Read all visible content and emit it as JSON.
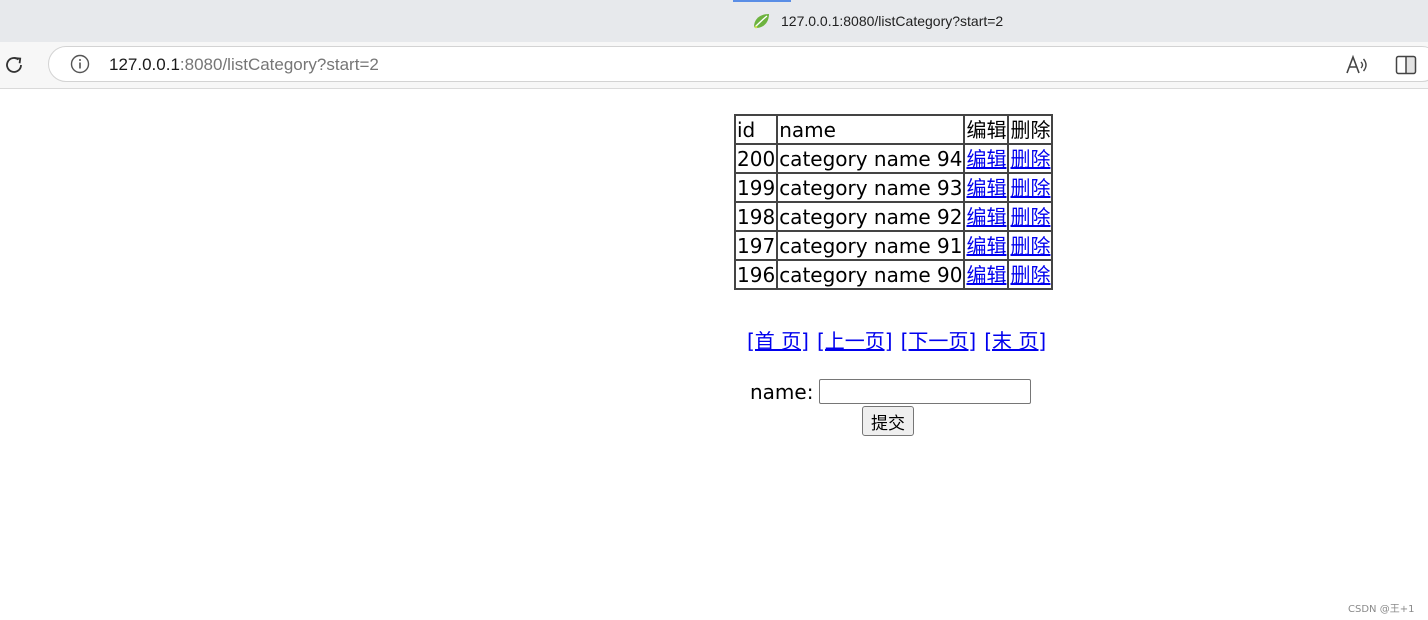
{
  "tab": {
    "title": "127.0.0.1:8080/listCategory?start=2",
    "favicon": "spring-leaf-icon",
    "favicon_color": "#6db33f"
  },
  "toolbar": {
    "reload_icon": "reload-icon",
    "info_icon": "info-icon",
    "url_host": "127.0.0.1",
    "url_rest": ":8080/listCategory?start=2",
    "read_aloud_icon": "read-aloud-icon",
    "split_screen_icon": "split-screen-icon"
  },
  "table": {
    "headers": [
      "id",
      "name",
      "编辑",
      "删除"
    ],
    "rows": [
      {
        "id": "200",
        "name": "category name 94",
        "edit": "编辑",
        "delete": "删除"
      },
      {
        "id": "199",
        "name": "category name 93",
        "edit": "编辑",
        "delete": "删除"
      },
      {
        "id": "198",
        "name": "category name 92",
        "edit": "编辑",
        "delete": "删除"
      },
      {
        "id": "197",
        "name": "category name 91",
        "edit": "编辑",
        "delete": "删除"
      },
      {
        "id": "196",
        "name": "category name 90",
        "edit": "编辑",
        "delete": "删除"
      }
    ]
  },
  "pager": {
    "first": "[首 页]",
    "prev": "[上一页]",
    "next": "[下一页]",
    "last": "[末 页]"
  },
  "form": {
    "name_label": "name:",
    "name_value": "",
    "submit_label": "提交"
  },
  "watermark": "CSDN @王+1",
  "colors": {
    "link": "#0000ee",
    "table_border": "#444444",
    "tabstrip_bg": "#e7e9ec"
  }
}
